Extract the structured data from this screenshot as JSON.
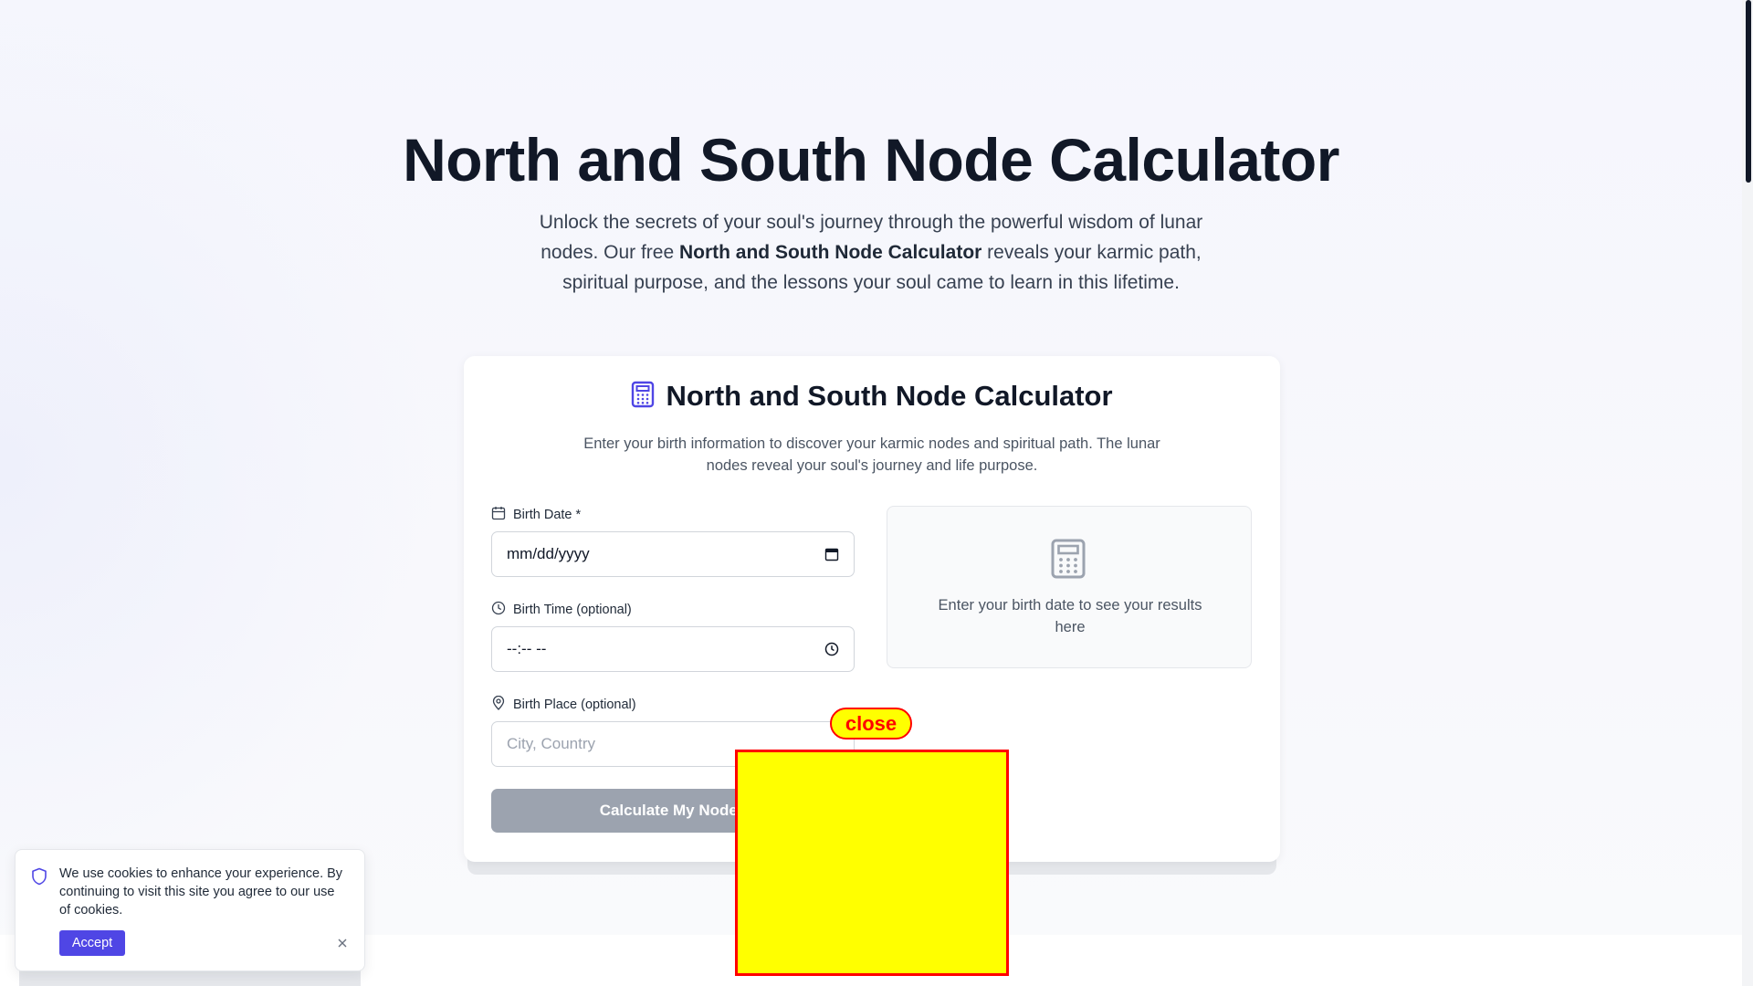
{
  "hero": {
    "title": "North and South Node Calculator",
    "desc_before": "Unlock the secrets of your soul's journey through the powerful wisdom of lunar nodes. Our free ",
    "desc_bold": "North and South Node Calculator",
    "desc_after": " reveals your karmic path, spiritual purpose, and the lessons your soul came to learn in this lifetime."
  },
  "calculator": {
    "icon": "calculator-icon",
    "title": "North and South Node Calculator",
    "description": "Enter your birth information to discover your karmic nodes and spiritual path. The lunar nodes reveal your soul's journey and life purpose.",
    "fields": {
      "birth_date": {
        "icon": "calendar-icon",
        "label": "Birth Date *",
        "value": "mm/dd/yyyy"
      },
      "birth_time": {
        "icon": "clock-icon",
        "label": "Birth Time (optional)",
        "value": "--:-- --"
      },
      "birth_place": {
        "icon": "map-pin-icon",
        "label": "Birth Place (optional)",
        "placeholder": "City, Country"
      }
    },
    "submit_label": "Calculate My Nodes",
    "results": {
      "icon": "calculator-icon",
      "placeholder_text": "Enter your birth date to see your results here"
    }
  },
  "ad_overlay": {
    "close_label": "close"
  },
  "cookie_banner": {
    "icon": "shield-icon",
    "text": "We use cookies to enhance your experience. By continuing to visit this site you agree to our use of cookies.",
    "accept_label": "Accept",
    "close_icon": "close-icon"
  },
  "colors": {
    "accent": "#4f46e5",
    "button_disabled": "#9ca3af",
    "ad_fill": "#ffff00",
    "ad_border": "#ff0000"
  }
}
